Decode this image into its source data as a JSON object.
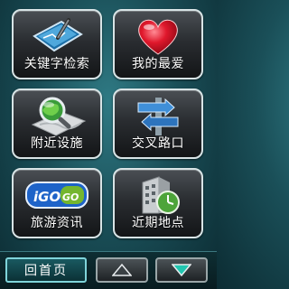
{
  "menu": {
    "items": [
      {
        "label": "关键字检索",
        "icon": "tablet-pen-icon"
      },
      {
        "label": "我的最爱",
        "icon": "heart-icon"
      },
      {
        "label": "附近设施",
        "icon": "magnifier-map-icon"
      },
      {
        "label": "交叉路口",
        "icon": "crossroad-sign-icon"
      },
      {
        "label": "旅游资讯",
        "icon": "igogo-logo-icon"
      },
      {
        "label": "近期地点",
        "icon": "building-clock-icon"
      }
    ]
  },
  "bottom_bar": {
    "home_label": "回首页",
    "up_icon": "triangle-up-icon",
    "down_icon": "triangle-down-icon"
  },
  "logo_text": "iGO GO",
  "colors": {
    "background": "#1a4f58",
    "tile_border": "#d8e4e6",
    "heart": "#e0182c",
    "down_arrow": "#21c6b0"
  }
}
